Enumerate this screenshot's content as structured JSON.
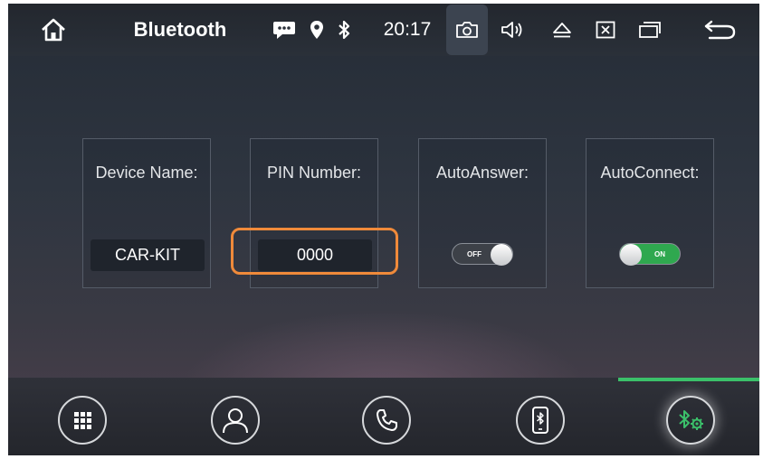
{
  "statusbar": {
    "title": "Bluetooth",
    "time": "20:17",
    "icons": [
      "home-icon",
      "message-icon",
      "location-pin-icon",
      "bluetooth-icon",
      "camera-icon",
      "volume-icon",
      "eject-icon",
      "close-window-icon",
      "recent-apps-icon",
      "back-icon"
    ]
  },
  "settings": [
    {
      "label": "Device Name:",
      "value": "CAR-KIT"
    },
    {
      "label": "PIN Number:",
      "value": "0000"
    },
    {
      "label": "AutoAnswer:",
      "toggle_text": "OFF",
      "state": "off"
    },
    {
      "label": "AutoConnect:",
      "toggle_text": "ON",
      "state": "on"
    }
  ],
  "dock": {
    "items": [
      "apps-grid-icon",
      "contacts-icon",
      "phone-icon",
      "phone-bluetooth-icon",
      "bluetooth-settings-icon"
    ],
    "active": "bluetooth-settings-icon",
    "active_color": "#3bc06a"
  },
  "colors": {
    "highlight": "#f08a3a",
    "toggle_on": "#2fa84f"
  }
}
